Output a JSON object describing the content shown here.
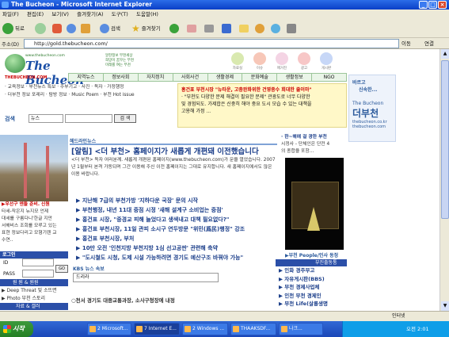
{
  "window": {
    "title": "The Bucheon - Microsoft Internet Explorer",
    "min": "_",
    "max": "□",
    "close": "×"
  },
  "menu": [
    "파일(F)",
    "편집(E)",
    "보기(V)",
    "즐겨찾기(A)",
    "도구(T)",
    "도움말(H)"
  ],
  "toolbar": {
    "back": "뒤로",
    "search": "검색",
    "favorites": "즐겨찾기"
  },
  "address": {
    "label": "주소(D)",
    "url": "http://gold.thebucheon.com/",
    "go": "이동",
    "links": "연결"
  },
  "logo": {
    "site": "www.thebucheon.com",
    "name": "The Bucheon",
    "slogan_1": "알찬정보 부천세상",
    "slogan_2": "희망이 꿈꾸는 부천",
    "slogan_3": "미래를 여는 부천"
  },
  "top_icons": [
    "자료실",
    "이슈",
    "매거진",
    "광고",
    "게시판"
  ],
  "tagline": "THEBUCHEON.COM",
  "nav": [
    "지역뉴스",
    "정보사회",
    "자치정치",
    "사회사건",
    "생활경제",
    "문화예술",
    "생활정보",
    "NGO"
  ],
  "subnav": {
    "line1": "· 교육정보 · 부천뉴스 특보 · 주부기고 · 사진 · 독자 · 가정행정",
    "line2": "· 더부천 정보 포레리 · 탐방 정보 · Music Poem · 부천 Hot issue"
  },
  "search": {
    "label": "검색",
    "scope": "뉴스",
    "button": "검 색"
  },
  "notice": {
    "title": "홍건표 부천시장 \"뉴타운, 고충완화위한 건영종수 회대한 줄이마\"",
    "body1": "· \"부천도 다양한 문제 해결이 필요한 문제\"   관광도로 너무 다양한",
    "body2": "및 경험되도. 가제합은 신중히 해야 중요 도시 모습 수 있는 대책을",
    "body3": "고용해 가정 ..."
  },
  "rightad": {
    "line1": "바르고",
    "line2": "신속한...",
    "brand_en": "The Bucheon",
    "brand_kr": "더부천",
    "url1": "thebucheon.co.kr",
    "url2": "thebucheon.com"
  },
  "headline_bar": "헤드라인뉴스",
  "headline": "[알림] <더 부천> 홈페이지가 새롭게 개편돼 이전했습니다",
  "summary": "<더 부천> 독자 여러분께. 새롭게 개편된 홈페이지(www.thebucheon.com)가 문을 열었습니다. 2007년 1월부터 본격 가동되며 그간 이용해 주신 이전 홈페이지는 그대로 유지합니다. 새 홈페이지에서도 많은 이용 바랍니다.",
  "news": [
    "▶ 지난해 7급의 부천가방 '지하다운 국장' 문의 시작",
    "▶ 부천행정, 내년 11대 중점 시정 '새해 설계구 소비업는 중점'",
    "▶ 홍건표 시장, \"중경교 피해 늘었다고 생색내고 대책 필요없다?\"",
    "▶ 홍건표 부천시장, 11일 관피 소시구 연두방문 \"위민(爲民)행정\" 강조",
    "▶ 홍건표 부천시장, 부처",
    "▶ 10만 오전 '인천지방 부천지방 1심 선고공판' 관련해 축약",
    "▶ \"도시철도 시청, 도제 시설 가능하려면 경기도 예산구조 바꿔야 가능\""
  ],
  "leftcap": {
    "h": "▶우선구 엔둘 준비. 신원",
    "l1": "타세-작은지 뉴지모 언제",
    "l2": "대세를 구름다니'한글 지만",
    "l3": "서해비스 조회를 모루고 있는",
    "l4": "표현 정보다리고 모형기렌 교",
    "l5": "수연.."
  },
  "login": {
    "bar": "로그인",
    "id": "ID",
    "pass": "PASS",
    "go": "GO",
    "blue": "원 원 & 원원",
    "menu1": "▶ Deep Threat 및 소뜨면",
    "menu2": "▶ Photo 부천 스토리",
    "blue2": "자료 & 갤러"
  },
  "kbs": {
    "label": "KBS 뉴스 속보",
    "box": "드리라"
  },
  "bottom": "○천서 경기도 대중교통과장, 소사구청장에 내정",
  "rtext": {
    "l1": "· 한~해에 걸 광한 부천",
    "l2": "시정사 - 단체인은 단전 4",
    "l3": "의 종합을 포함..."
  },
  "rlink": "▶부천 People/인사 동정",
  "rbar": "부진출동통",
  "rlist": [
    "▶ 인화 경주부고",
    "▶ 자유게시판(BBS)",
    "▶ 부천 경제사업체",
    "▶ 인천 부천 경제인",
    "▶ 부천 Life(살롱생명"
  ],
  "status": {
    "zone": "인터넷"
  },
  "taskbar": {
    "start": "시작",
    "tasks": [
      "2 Microsoft...",
      "7 Internet E...",
      "2 Windows ...",
      "THAAKSDF...",
      "나크..."
    ],
    "time": "오전 2:01"
  },
  "colors": {
    "titlebar": "#0a3fc7",
    "accent": "#1b3e8a",
    "nav": "#eaf5e8"
  }
}
